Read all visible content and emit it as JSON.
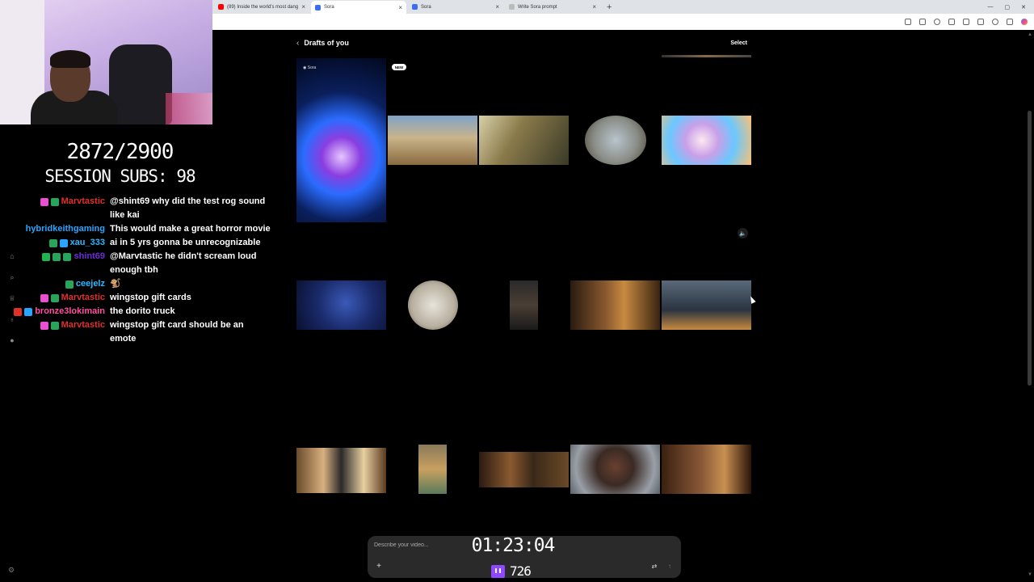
{
  "browser": {
    "tabs": [
      {
        "title": "(89) Inside the world's most dang",
        "icon_color": "#ff0000"
      },
      {
        "title": "Sora",
        "icon_color": "#3b6ef5",
        "active": true
      },
      {
        "title": "Sora",
        "icon_color": "#3b6ef5"
      },
      {
        "title": "Write Sora prompt",
        "icon_color": "#bbbbbb"
      }
    ],
    "new_tab": "+",
    "window_controls": [
      "—",
      "▢",
      "✕"
    ]
  },
  "overlay": {
    "counter": "2872/2900",
    "session_subs": "SESSION SUBS: 98",
    "timer": "01:23:04",
    "viewers": "726"
  },
  "chat": [
    {
      "user": "Marvtastic",
      "color": "#e0302a",
      "badges": [
        "pink",
        "green"
      ],
      "text": "@shint69 why did the test rog sound like kai"
    },
    {
      "user": "hybridkeithgaming",
      "color": "#2aa4ff",
      "badges": [],
      "text": "This would make a great horror movie"
    },
    {
      "user": "xau_333",
      "color": "#2ab8ff",
      "badges": [
        "green",
        "blue"
      ],
      "text": "ai in 5 yrs gonna be unrecognizable"
    },
    {
      "user": "shint69",
      "color": "#6b2bd6",
      "badges": [
        "check",
        "green",
        "green"
      ],
      "text": "@Marvtastic he didn't scream loud enough tbh"
    },
    {
      "user": "ceejelz",
      "color": "#2ab8ff",
      "badges": [
        "green"
      ],
      "text": "🐒"
    },
    {
      "user": "Marvtastic",
      "color": "#e0302a",
      "badges": [
        "pink",
        "green"
      ],
      "text": "wingstop gift cards"
    },
    {
      "user": "bronze3lokimain",
      "color": "#ff4fa0",
      "badges": [
        "red",
        "blue"
      ],
      "text": "the dorito truck"
    },
    {
      "user": "Marvtastic",
      "color": "#e0302a",
      "badges": [
        "pink",
        "green"
      ],
      "text": "wingstop gift card should be an emote"
    }
  ],
  "sora": {
    "page_title": "Drafts of you",
    "select_label": "Select",
    "new_badge": "NEW",
    "prompt_placeholder": "Describe your video...",
    "plus_label": "+",
    "send_label": "↑"
  },
  "sidebar_icons": [
    "home-icon",
    "search-icon",
    "trophy-icon",
    "bulb-icon",
    "avatar-icon"
  ]
}
